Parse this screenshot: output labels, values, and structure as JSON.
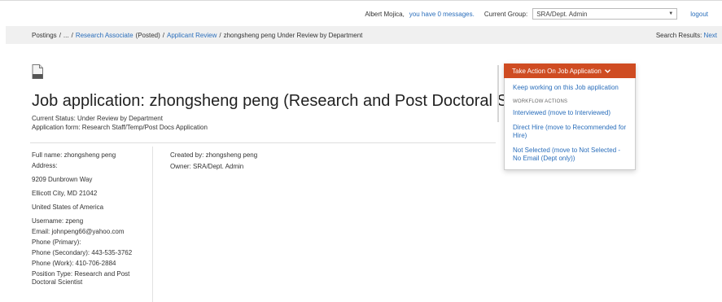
{
  "header": {
    "user_name": "Albert Mojica,",
    "messages_link": "you have 0 messages.",
    "group_label": "Current Group:",
    "group_value": "SRA/Dept. Admin",
    "logout": "logout"
  },
  "breadcrumb": {
    "postings": "Postings",
    "sep1": "/",
    "ellipsis": "...",
    "sep2": "/",
    "job_link": "Research Associate",
    "job_state": "(Posted)",
    "sep3": "/",
    "review_link": "Applicant Review",
    "sep4": "/",
    "current": "zhongsheng peng Under Review by Department",
    "search_results_label": "Search Results:",
    "next_link": "Next"
  },
  "page": {
    "title": "Job application: zhongsheng peng (Research and Post Doctoral Scientist)",
    "status": "Current Status: Under Review by Department",
    "form": "Application form: Research Staff/Temp/Post Docs Application"
  },
  "applicant": {
    "full_name": "Full name: zhongsheng peng",
    "address_label": "Address:",
    "address_line1": "9209 Dunbrown Way",
    "address_line2": "Ellicott City, MD 21042",
    "address_line3": "United States of America",
    "username": "Username: zpeng",
    "email": "Email: johnpeng66@yahoo.com",
    "phone_primary": "Phone (Primary):",
    "phone_secondary": "Phone (Secondary): 443-535-3762",
    "phone_work": "Phone (Work): 410-706-2884",
    "position_type": "Position Type: Research and Post Doctoral Scientist"
  },
  "meta": {
    "created_by": "Created by: zhongsheng peng",
    "owner": "Owner: SRA/Dept. Admin"
  },
  "actions": {
    "button_label": "Take Action On Job Application",
    "keep_working": "Keep working on this Job application",
    "workflow_header": "WORKFLOW ACTIONS",
    "interviewed": "Interviewed (move to Interviewed)",
    "direct_hire": "Direct Hire (move to Recommended for Hire)",
    "not_selected": "Not Selected (move to Not Selected - No Email (Dept only))"
  },
  "icons": {
    "document": "document-icon",
    "dropdown_arrow": "chevron-down-icon",
    "select_arrow": "select-arrow-icon"
  },
  "colors": {
    "accent": "#cf4c22",
    "link": "#2a6ebb"
  }
}
